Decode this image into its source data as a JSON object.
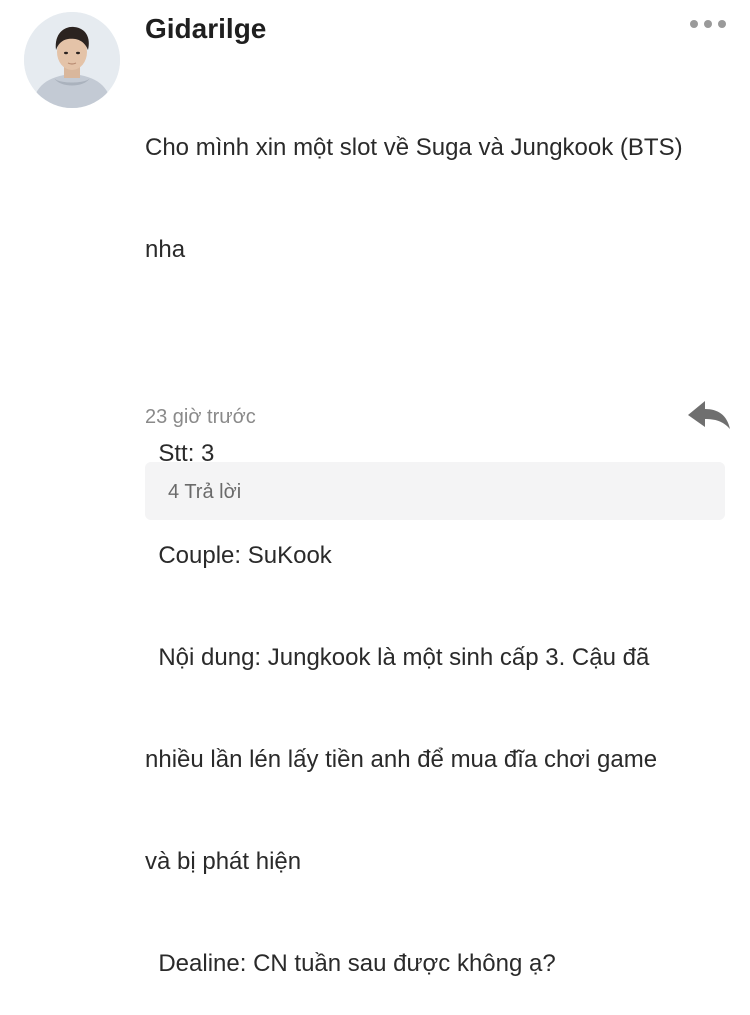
{
  "comment": {
    "username": "Gidarilge",
    "body_lines": [
      "Cho mình xin một slot về Suga và Jungkook (BTS)",
      "nha",
      "",
      "  Stt: 3",
      "  Couple: SuKook",
      "  Nội dung: Jungkook là một sinh cấp 3. Cậu đã",
      "nhiều lần lén lấy tiền anh để mua đĩa chơi game",
      "và bị phát hiện",
      "  Dealine: CN tuần sau được không ạ?"
    ],
    "timestamp": "23 giờ trước",
    "replies_label": "4 Trả lời"
  },
  "icons": {
    "more": "more-horizontal-icon",
    "reply": "reply-arrow-icon"
  },
  "colors": {
    "username": "#1f1f1f",
    "text": "#2a2a2a",
    "muted": "#8a8a8a",
    "replies_bg": "#f4f4f5",
    "icon": "#6f6f6f"
  }
}
